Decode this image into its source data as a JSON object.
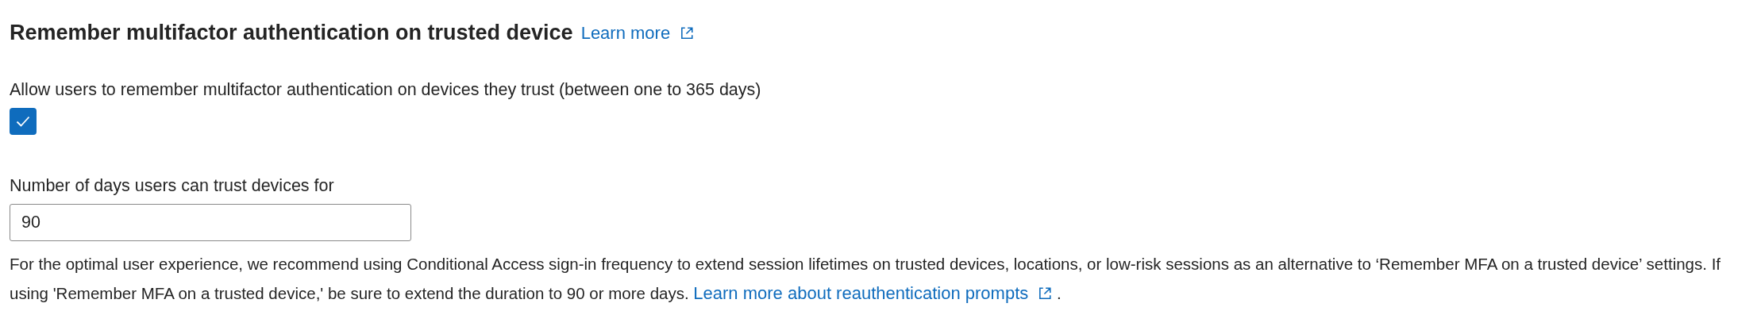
{
  "section": {
    "title": "Remember multifactor authentication on trusted device",
    "learn_more": "Learn more"
  },
  "remember_setting": {
    "label": "Allow users to remember multifactor authentication on devices they trust (between one to 365 days)",
    "checked": true
  },
  "days_field": {
    "label": "Number of days users can trust devices for",
    "value": "90"
  },
  "note": {
    "text": "For the optimal user experience, we recommend using Conditional Access sign-in frequency to extend session lifetimes on trusted devices, locations, or low-risk sessions as an alternative to ‘Remember MFA on a trusted device’ settings. If using 'Remember MFA on a trusted device,' be sure to extend the duration to 90 or more days.",
    "link": "Learn more about reauthentication prompts",
    "end": "."
  }
}
